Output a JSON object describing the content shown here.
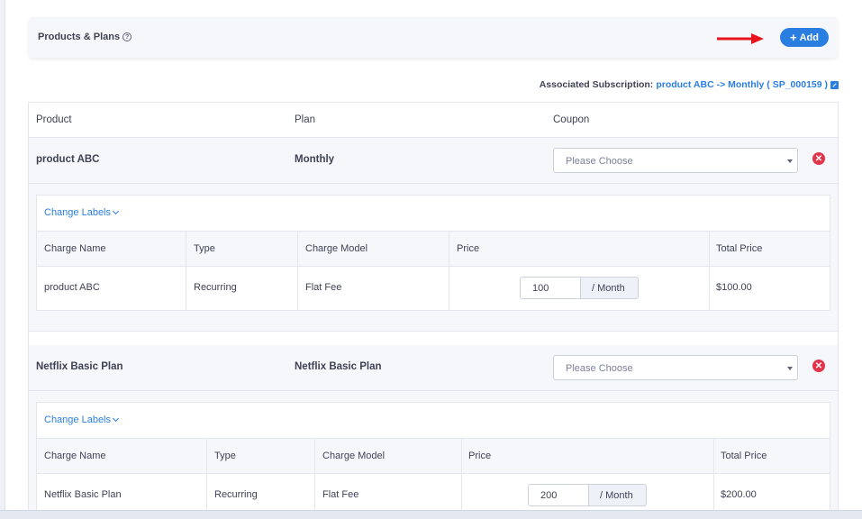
{
  "header": {
    "title": "Products & Plans",
    "add_label": "Add"
  },
  "associated": {
    "label": "Associated Subscription:",
    "link": "product ABC -> Monthly ( SP_000159 )"
  },
  "columns": {
    "product": "Product",
    "plan": "Plan",
    "coupon": "Coupon"
  },
  "charge_columns": {
    "name": "Charge Name",
    "type": "Type",
    "model": "Charge Model",
    "price": "Price",
    "total": "Total Price"
  },
  "items": [
    {
      "product": "product ABC",
      "plan": "Monthly",
      "coupon_placeholder": "Please Choose",
      "change_labels": "Change Labels",
      "charge": {
        "name": "product ABC",
        "type": "Recurring",
        "model": "Flat Fee",
        "price": "100",
        "unit": "/ Month",
        "total": "$100.00"
      }
    },
    {
      "product": "Netflix Basic Plan",
      "plan": "Netflix Basic Plan",
      "coupon_placeholder": "Please Choose",
      "change_labels": "Change Labels",
      "charge": {
        "name": "Netflix Basic Plan",
        "type": "Recurring",
        "model": "Flat Fee",
        "price": "200",
        "unit": "/ Month",
        "total": "$200.00"
      }
    }
  ],
  "colors": {
    "accent": "#2a7de1",
    "remove": "#e0354a",
    "panel": "#f6f7fb",
    "arrow": "#e8141b"
  }
}
